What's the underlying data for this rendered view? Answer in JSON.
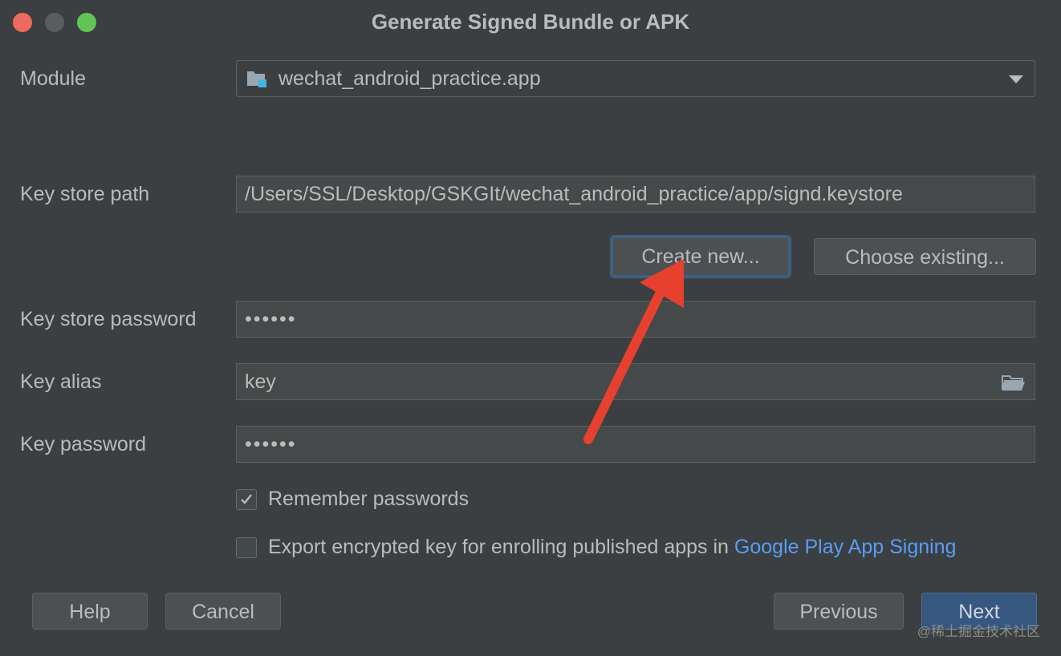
{
  "window": {
    "title": "Generate Signed Bundle or APK"
  },
  "module": {
    "label": "Module",
    "value": "wechat_android_practice.app",
    "icon": "module-folder-icon"
  },
  "keystore": {
    "path_label": "Key store path",
    "path_value": "/Users/SSL/Desktop/GSKGIt/wechat_android_practice/app/signd.keystore",
    "create_new": "Create new...",
    "choose_existing": "Choose existing..."
  },
  "keystore_password": {
    "label": "Key store password",
    "value": "••••••"
  },
  "key_alias": {
    "label": "Key alias",
    "value": "key",
    "icon": "folder-open-icon"
  },
  "key_password": {
    "label": "Key password",
    "value": "••••••"
  },
  "remember": {
    "label": "Remember passwords",
    "checked": true
  },
  "export": {
    "label": "Export encrypted key for enrolling published apps in ",
    "link": "Google Play App Signing",
    "checked": false
  },
  "buttons": {
    "help": "Help",
    "cancel": "Cancel",
    "previous": "Previous",
    "next": "Next"
  },
  "watermark": "@稀土掘金技术社区",
  "colors": {
    "background": "#3c3f41",
    "field": "#45494a",
    "primary": "#365880",
    "link": "#589df6",
    "annotation_arrow": "#e8402f"
  }
}
